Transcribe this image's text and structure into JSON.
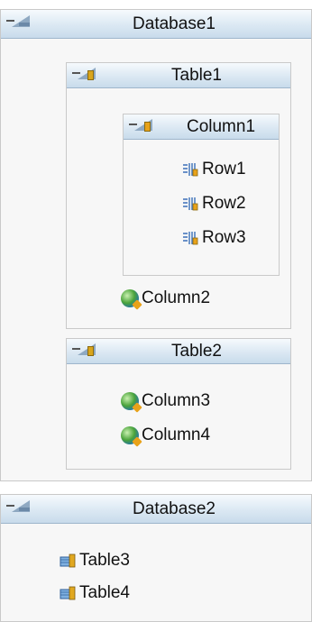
{
  "databases": [
    {
      "name": "Database1",
      "tables": [
        {
          "name": "Table1",
          "columns": [
            {
              "name": "Column1",
              "rows": [
                "Row1",
                "Row2",
                "Row3"
              ]
            },
            {
              "name": "Column2"
            }
          ]
        },
        {
          "name": "Table2",
          "columns": [
            {
              "name": "Column3"
            },
            {
              "name": "Column4"
            }
          ]
        }
      ]
    },
    {
      "name": "Database2",
      "tables": [
        {
          "name": "Table3"
        },
        {
          "name": "Table4"
        }
      ]
    }
  ],
  "icons": {
    "collapse": "collapse-toggle-icon",
    "row": "row-icon",
    "column": "column-globe-icon",
    "table": "table-icon"
  },
  "colors": {
    "header_top": "#f6fafd",
    "header_bottom": "#c8dbeb",
    "panel_bg": "#f7f7f7",
    "border": "#c9c9c9"
  }
}
